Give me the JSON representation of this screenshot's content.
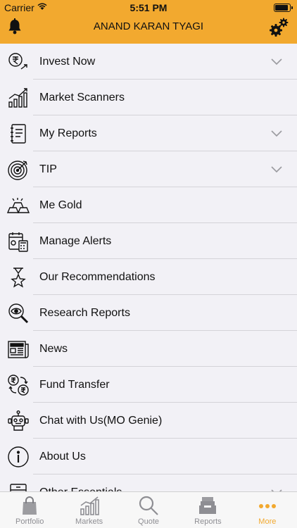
{
  "status_bar": {
    "carrier": "Carrier",
    "time": "5:51 PM"
  },
  "header": {
    "title": "ANAND KARAN TYAGI",
    "left_icon": "bell-icon",
    "right_icon": "settings-gears-icon"
  },
  "colors": {
    "accent": "#f2a92f",
    "background": "#f2f1f6",
    "inactive_tab": "#8e8e93"
  },
  "menu": [
    {
      "label": "Invest Now",
      "icon": "rupee-invest-icon",
      "expandable": true
    },
    {
      "label": "Market Scanners",
      "icon": "bar-chart-trend-icon",
      "expandable": false
    },
    {
      "label": "My Reports",
      "icon": "report-book-icon",
      "expandable": true
    },
    {
      "label": "TIP",
      "icon": "target-icon",
      "expandable": true
    },
    {
      "label": "Me Gold",
      "icon": "gold-bars-icon",
      "expandable": false
    },
    {
      "label": "Manage Alerts",
      "icon": "calendar-calculator-icon",
      "expandable": false
    },
    {
      "label": "Our Recommendations",
      "icon": "hourglass-star-icon",
      "expandable": false
    },
    {
      "label": "Research Reports",
      "icon": "magnifier-eye-icon",
      "expandable": false
    },
    {
      "label": "News",
      "icon": "newspaper-icon",
      "expandable": false
    },
    {
      "label": "Fund Transfer",
      "icon": "rupee-transfer-icon",
      "expandable": false
    },
    {
      "label": "Chat with Us(MO Genie)",
      "icon": "robot-icon",
      "expandable": false
    },
    {
      "label": "About Us",
      "icon": "info-icon",
      "expandable": false
    },
    {
      "label": "Other Essentials",
      "icon": "drawer-icon",
      "expandable": true
    }
  ],
  "tabs": [
    {
      "label": "Portfolio",
      "icon": "shopping-bag-icon",
      "active": false
    },
    {
      "label": "Markets",
      "icon": "chart-icon",
      "active": false
    },
    {
      "label": "Quote",
      "icon": "search-icon",
      "active": false
    },
    {
      "label": "Reports",
      "icon": "inbox-icon",
      "active": false
    },
    {
      "label": "More",
      "icon": "more-dots-icon",
      "active": true
    }
  ]
}
